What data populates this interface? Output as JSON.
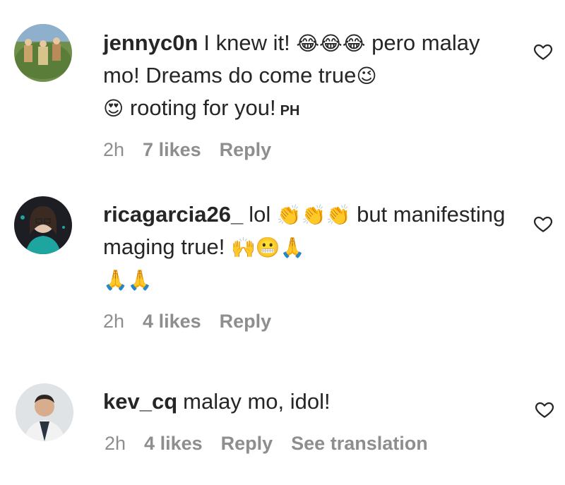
{
  "comments": [
    {
      "username": "jennyc0n",
      "text_1": "I knew it!",
      "emoji_1": "😂😂😂",
      "text_2": "pero malay mo! Dreams do come true",
      "emoji_2": "😉",
      "emoji_3": "😍",
      "text_3": "rooting for you!",
      "country": "PH",
      "time": "2h",
      "likes": "7 likes",
      "reply": "Reply"
    },
    {
      "username": "ricagarcia26_",
      "text_1": "lol",
      "emoji_1": "👏👏👏",
      "text_2": "but manifesting maging true!",
      "emoji_2": "🙌😬🙏",
      "emoji_3": "🙏🙏",
      "time": "2h",
      "likes": "4 likes",
      "reply": "Reply"
    },
    {
      "username": "kev_cq",
      "text_1": "malay mo, idol!",
      "time": "2h",
      "likes": "4 likes",
      "reply": "Reply",
      "translation": "See translation"
    }
  ],
  "icons": {
    "like": "heart-outline-icon",
    "heart_color": "#262626"
  }
}
